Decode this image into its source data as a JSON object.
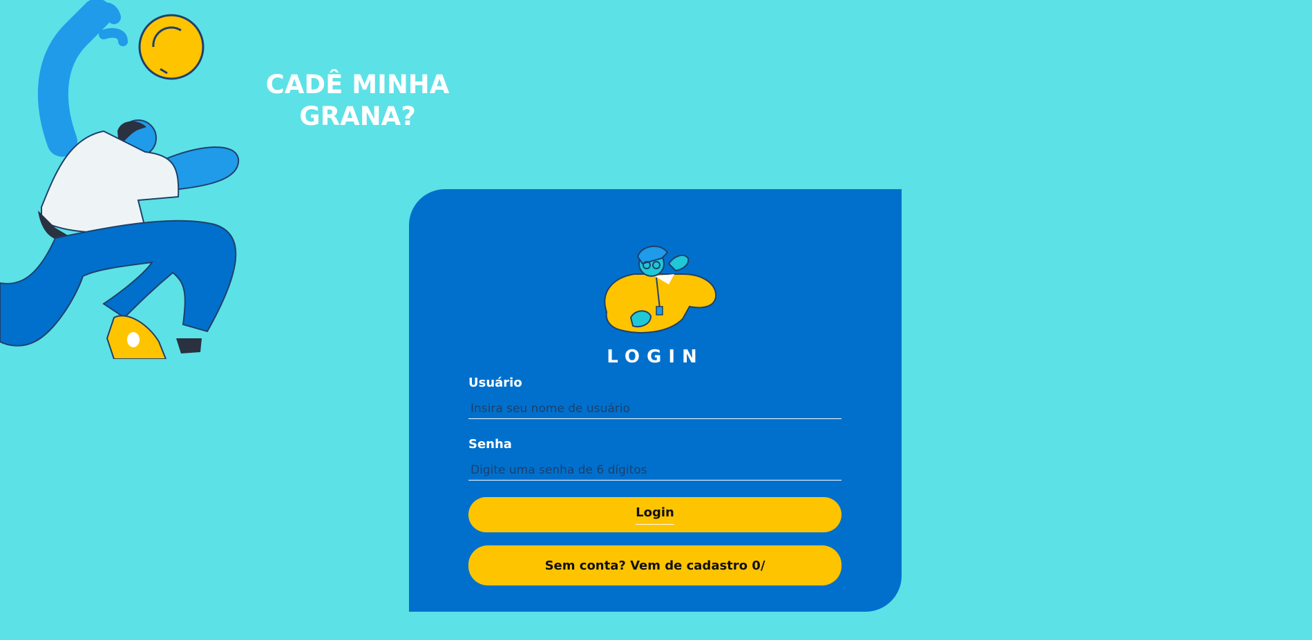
{
  "brand": {
    "title_line1": "CADÊ MINHA",
    "title_line2": "GRANA?"
  },
  "login": {
    "heading": "LOGIN",
    "username_label": "Usuário",
    "username_placeholder": "Insira seu nome de usuário",
    "username_value": "",
    "password_label": "Senha",
    "password_placeholder": "Digite uma senha de 6 dígitos",
    "password_value": "",
    "submit_label": "Login",
    "signup_label": "Sem conta? Vem de cadastro 0/"
  },
  "colors": {
    "background": "#5ce1e6",
    "card": "#0070cc",
    "accent": "#ffc400",
    "text_light": "#ffffff"
  },
  "icons": {
    "hero": "person-reaching-coin-illustration",
    "card": "person-peace-sign-illustration"
  }
}
